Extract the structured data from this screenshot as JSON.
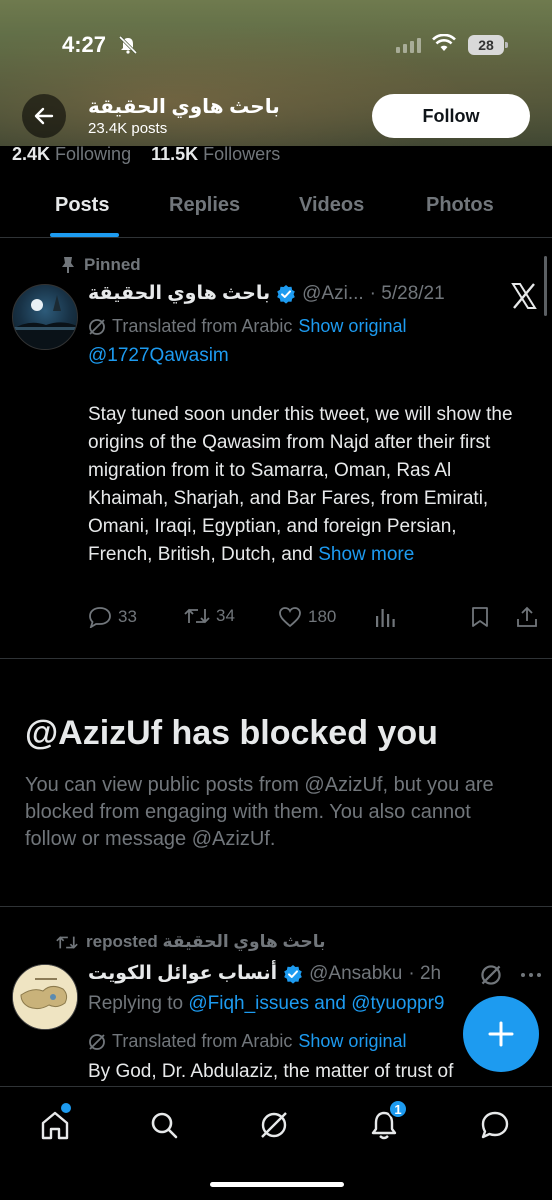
{
  "status_bar": {
    "time": "4:27",
    "battery": "28"
  },
  "header": {
    "profile_name": "باحث هاوي الحقيقة",
    "post_count": "23.4K posts",
    "follow_label": "Follow"
  },
  "stats": {
    "following_count": "2.4K",
    "following_label": "Following",
    "followers_count": "11.5K",
    "followers_label": "Followers"
  },
  "tabs": [
    "Posts",
    "Replies",
    "Videos",
    "Photos"
  ],
  "pinned_post": {
    "pinned_label": "Pinned",
    "author": "باحث هاوي الحقيقة",
    "handle": "@Azi...",
    "date": "· 5/28/21",
    "translated_label": "Translated from Arabic",
    "show_original": "Show original",
    "mention": "@1727Qawasim",
    "body": "Stay tuned soon under this tweet, we will show the origins of the Qawasim from Najd after their first migration from it to Samarra, Oman, Ras Al Khaimah, Sharjah, and Bar Fares, from Emirati, Omani, Iraqi, Egyptian, and foreign Persian, French, British, Dutch, and",
    "show_more": "Show more",
    "replies": "33",
    "reposts": "34",
    "likes": "180"
  },
  "blocked": {
    "title": "@AzizUf has blocked you",
    "text": "You can view public posts from @AzizUf, but you are blocked from engaging with them. You also cannot follow or message @AzizUf."
  },
  "repost": {
    "reposted_label": "باحث هاوي الحقيقة reposted",
    "author": "أنساب عوائل الكويت",
    "handle": "@Ansabku",
    "time": "· 2h",
    "replying_prefix": "Replying to",
    "replying_to": "@Fiqh_issues and @tyuoppr9",
    "translated_label": "Translated from Arabic",
    "show_original": "Show original",
    "body": "By God, Dr. Abdulaziz, the matter of trust of"
  },
  "bottom_nav": {
    "notification_count": "1"
  },
  "colors": {
    "accent": "#1d9bf0",
    "verified": "#1d9bf0",
    "background": "#000000",
    "muted_text": "#71767b"
  }
}
